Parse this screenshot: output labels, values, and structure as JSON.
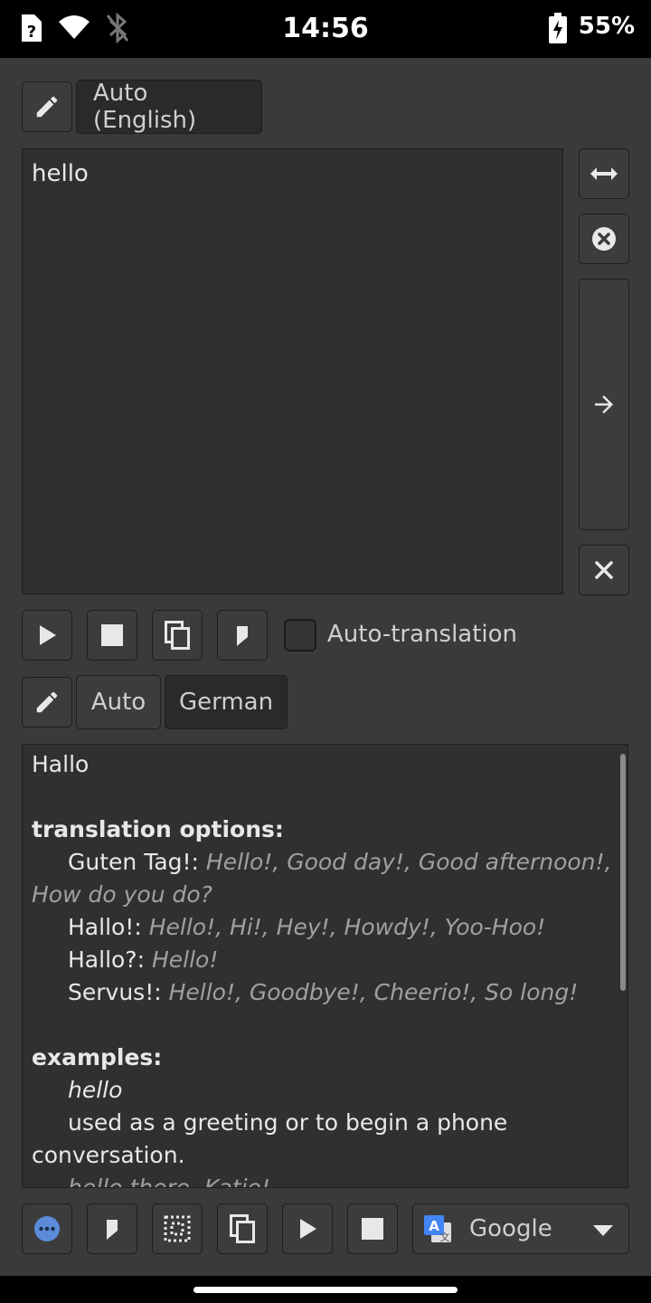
{
  "status": {
    "time": "14:56",
    "battery": "55%"
  },
  "source": {
    "language": "Auto (English)",
    "text": "hello"
  },
  "controls": {
    "auto_translation": "Auto-translation"
  },
  "target": {
    "lang_auto": "Auto",
    "lang_selected": "German"
  },
  "translation": {
    "main": "Hallo",
    "options_header": "translation options:",
    "options": [
      {
        "term": "Guten Tag!:",
        "alts": "Hello!, Good day!, Good afternoon!, How do you do?"
      },
      {
        "term": "Hallo!:",
        "alts": "Hello!, Hi!, Hey!, Howdy!, Yoo-Hoo!"
      },
      {
        "term": "Hallo?:",
        "alts": "Hello!"
      },
      {
        "term": "Servus!:",
        "alts": "Hello!, Goodbye!, Cheerio!, So long!"
      }
    ],
    "examples_header": "examples:",
    "example_word": "hello",
    "example_def": "used as a greeting or to begin a phone conversation.",
    "example_sentence": "hello there, Katie!"
  },
  "engine": {
    "name": "Google"
  },
  "icons": {
    "edit": "pencil-icon",
    "swap": "swap-icon",
    "clear": "clear-circle-icon",
    "translate": "arrow-right-icon",
    "close": "close-icon",
    "play": "play-icon",
    "stop": "stop-icon",
    "copy": "copy-icon",
    "bookmark": "bookmark-icon",
    "more": "more-icon",
    "select_all": "select-all-icon",
    "dropdown": "chevron-down-icon"
  },
  "colors": {
    "accent": "#5b8bd9",
    "background": "#3a3a3a",
    "panel": "#303030"
  }
}
